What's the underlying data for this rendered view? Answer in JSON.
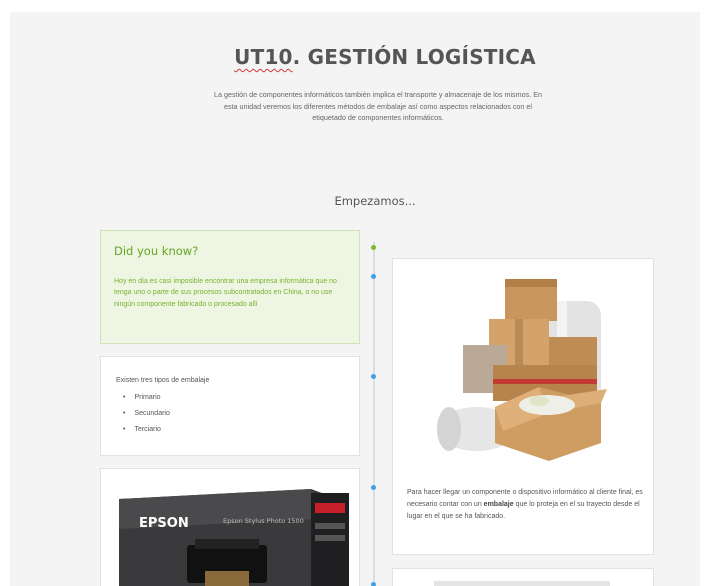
{
  "header": {
    "title_prefix": "UT10",
    "title_rest": ". GESTIÓN LOGÍSTICA",
    "intro": "La gestión de componentes informáticos también implica el transporte y almacenaje de los mismos. En esta unidad veremos los diferentes métodos de embalaje así como aspectos relacionados con el etiquetado de componentes informáticos."
  },
  "section": {
    "start_label": "Empezamos..."
  },
  "did_you_know": {
    "heading": "Did you know?",
    "text": "Hoy en día es casi imposible encontrar una empresa informática que no tenga uno o parte de sus procesos subcontratados en China, o no use ningún componente fabricado o procesado allí"
  },
  "packaging_types": {
    "intro": "Existen tres tipos de embalaje",
    "items": [
      "Primario",
      "Secundario",
      "Terciario"
    ]
  },
  "boxes_card": {
    "text_before": "Para hacer llegar un componente o dispositivo informático al cliente final, es necesario contar con un ",
    "text_bold": "embalaje",
    "text_after": " que lo proteja en el su trayecto desde el lugar en el que se ha fabricado."
  },
  "epson_card": {
    "brand": "EPSON",
    "model": "Epson Stylus Photo 1500"
  },
  "colors": {
    "accent_green": "#7cb82a",
    "accent_blue": "#3fa0e6",
    "title": "#555555"
  }
}
